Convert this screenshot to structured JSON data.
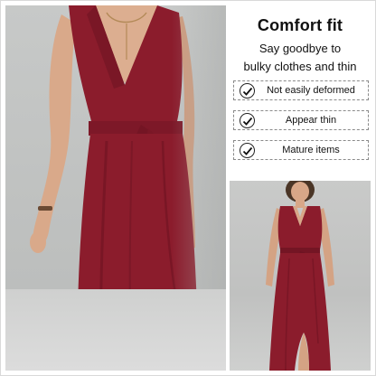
{
  "panel": {
    "title": "Comfort fit",
    "subtitle_line1": "Say goodbye to",
    "subtitle_line2": "bulky clothes and thin",
    "features": [
      {
        "label": "Not easily deformed",
        "icon": "checkmark-circle-icon"
      },
      {
        "label": "Appear thin",
        "icon": "checkmark-circle-icon"
      },
      {
        "label": "Mature items",
        "icon": "checkmark-circle-icon"
      }
    ]
  },
  "colors": {
    "dress": "#8b1c2c",
    "dress_shadow": "#6e1322",
    "skin": "#d9a98a",
    "wall": "#c4c6c5"
  }
}
